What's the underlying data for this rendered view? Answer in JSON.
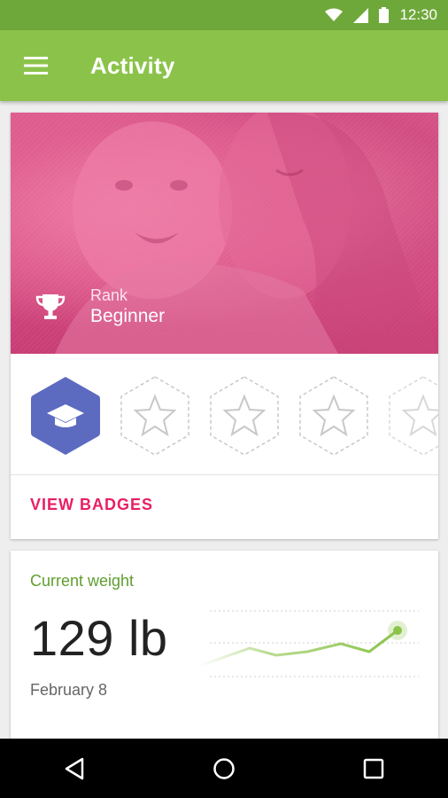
{
  "status_bar": {
    "time": "12:30",
    "icons": [
      "wifi-icon",
      "signal-icon",
      "battery-icon"
    ]
  },
  "app_bar": {
    "title": "Activity",
    "menu_icon": "menu-icon"
  },
  "rank_card": {
    "rank_label": "Rank",
    "rank_value": "Beginner",
    "badges": [
      {
        "icon": "graduation-cap-icon",
        "state": "earned"
      },
      {
        "icon": "star-icon",
        "state": "locked"
      },
      {
        "icon": "star-icon",
        "state": "locked"
      },
      {
        "icon": "star-icon",
        "state": "locked"
      },
      {
        "icon": "star-icon",
        "state": "locked"
      }
    ],
    "view_badges_label": "VIEW BADGES"
  },
  "weight_card": {
    "label": "Current weight",
    "value": "129 lb",
    "date": "February 8"
  },
  "colors": {
    "status_bar": "#6fa83a",
    "app_bar": "#8bc34a",
    "accent_pink": "#e91e63",
    "badge_blue": "#5c6bc0",
    "chart_green": "#8bc34a"
  },
  "nav_bar": {
    "buttons": [
      "back-icon",
      "home-icon",
      "recents-icon"
    ]
  }
}
